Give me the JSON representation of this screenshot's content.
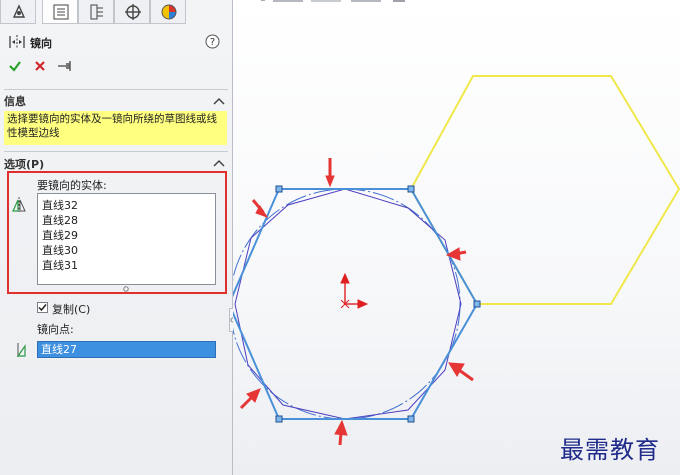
{
  "feature": {
    "title": "镜向",
    "help_icon": "help-icon",
    "confirm_icon": "check-icon",
    "cancel_icon": "close-icon",
    "pin_icon": "pushpin-icon"
  },
  "tabs": [
    {
      "icon": "feature-manager-icon"
    },
    {
      "icon": "property-manager-icon"
    },
    {
      "icon": "configuration-manager-icon"
    },
    {
      "icon": "dimxpert-icon"
    },
    {
      "icon": "display-manager-icon"
    }
  ],
  "info": {
    "header": "信息",
    "text": "选择要镜向的实体及一镜向所绕的草图线或线性模型边线"
  },
  "options": {
    "header": "选项(P)",
    "entities_label": "要镜向的实体:",
    "entities": [
      "直线32",
      "直线28",
      "直线29",
      "直线30",
      "直线31"
    ],
    "copy_label": "复制(C)",
    "copy_checked": true,
    "mirror_point_label": "镜向点:",
    "mirror_point_value": "直线27"
  },
  "watermark": "最需教育",
  "colors": {
    "sketch_blue": "#4a90d9",
    "selected_hex": "#f0e84a",
    "arrows": "#e63535",
    "highlight": "#ffff80"
  }
}
